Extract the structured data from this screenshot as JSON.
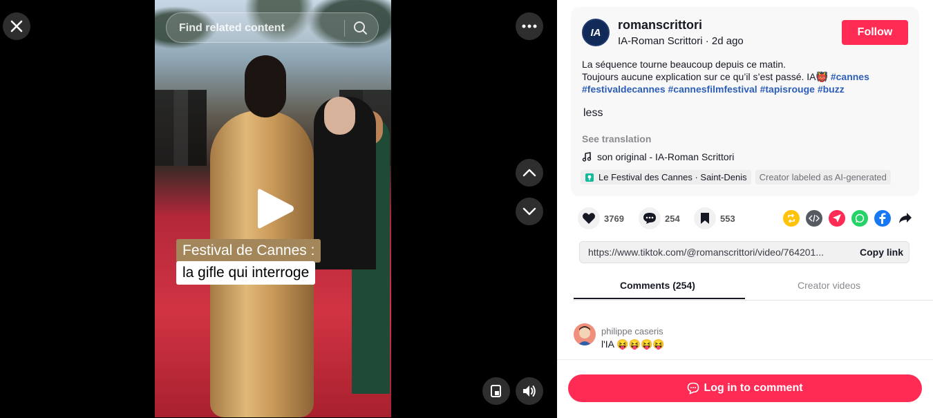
{
  "search": {
    "placeholder": "Find related content"
  },
  "video": {
    "caption_line1": "Festival de Cannes :",
    "caption_line2": "la gifle qui interroge"
  },
  "author": {
    "avatar_text": "IA",
    "username": "romanscrittori",
    "nickname": "IA-Roman Scrittori",
    "time": "2d ago",
    "follow_label": "Follow"
  },
  "description": {
    "line1": "La séquence tourne beaucoup depuis ce matin.",
    "line2": "Toujours aucune explication sur ce qu’il s’est passé. IA👹",
    "hashtags": [
      "#cannes",
      "#festivaldecannes",
      "#cannesfilmfestival",
      "#tapisrouge",
      "#buzz"
    ],
    "less_label": "less",
    "see_translation": "See translation"
  },
  "music": {
    "icon": "music-note-icon",
    "text": "son original - IA-Roman Scrittori"
  },
  "location": {
    "text": "Le Festival des Cannes · Saint-Denis",
    "ai_label": "Creator labeled as AI-generated"
  },
  "stats": {
    "likes": "3769",
    "comments": "254",
    "saves": "553"
  },
  "share_icons": [
    "repost-icon",
    "embed-icon",
    "send-icon",
    "whatsapp-icon",
    "facebook-icon",
    "share-arrow-icon"
  ],
  "link": {
    "url": "https://www.tiktok.com/@romanscrittori/video/764201...",
    "copy_label": "Copy link"
  },
  "tabs": [
    {
      "label": "Comments (254)",
      "active": true
    },
    {
      "label": "Creator videos",
      "active": false
    }
  ],
  "comments": [
    {
      "name": "philippe caseris",
      "text": "l'IA 😝😝😝😝"
    }
  ],
  "login": {
    "label": "Log in to comment"
  },
  "colors": {
    "accent": "#fe2c55",
    "hashtag": "#2b5db9"
  }
}
